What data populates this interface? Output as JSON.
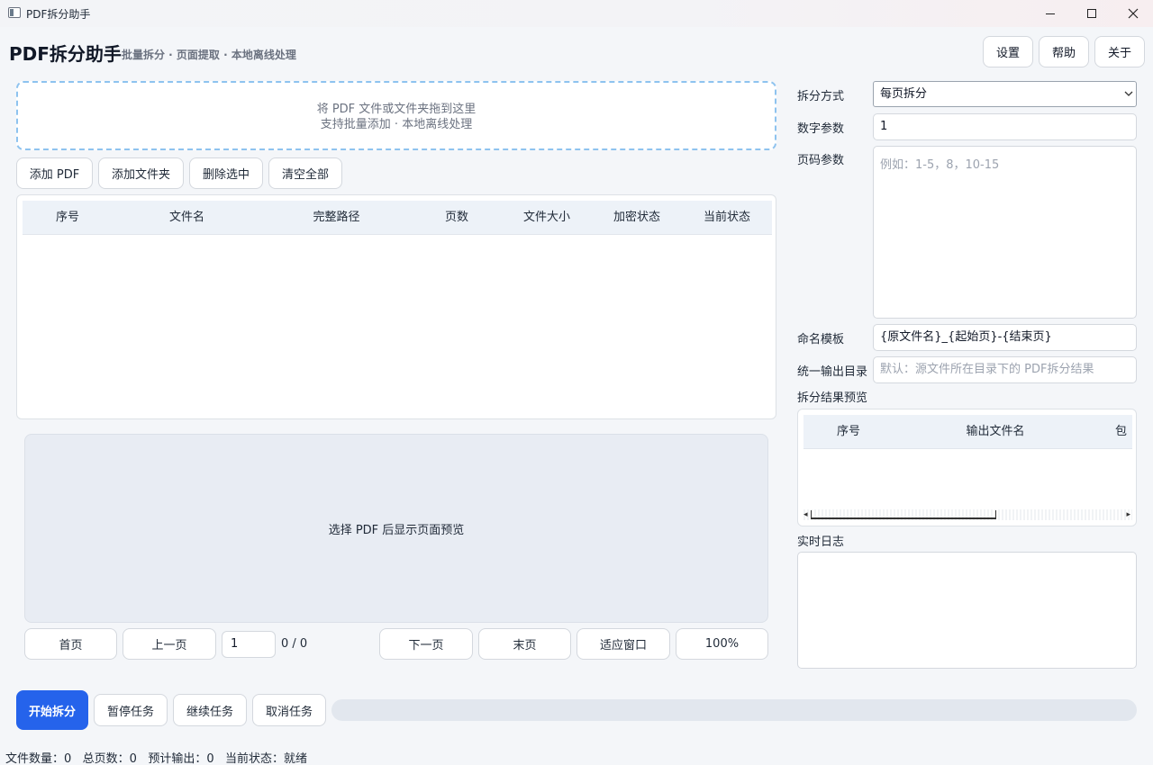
{
  "window": {
    "title": "PDF拆分助手"
  },
  "header": {
    "title": "PDF拆分助手",
    "subtitle": "批量拆分 · 页面提取 · 本地离线处理",
    "settings_label": "设置",
    "help_label": "帮助",
    "about_label": "关于"
  },
  "dropzone": {
    "line1": "将 PDF 文件或文件夹拖到这里",
    "line2": "支持批量添加 · 本地离线处理"
  },
  "file_actions": {
    "add_pdf": "添加 PDF",
    "add_folder": "添加文件夹",
    "delete_selected": "删除选中",
    "clear_all": "清空全部"
  },
  "file_table": {
    "columns": [
      "序号",
      "文件名",
      "完整路径",
      "页数",
      "文件大小",
      "加密状态",
      "当前状态"
    ],
    "rows": []
  },
  "preview": {
    "placeholder": "选择 PDF 后显示页面预览"
  },
  "pager": {
    "first": "首页",
    "prev": "上一页",
    "page_value": "1",
    "page_count": "0 / 0",
    "next": "下一页",
    "last": "末页",
    "fit": "适应窗口",
    "zoom": "100%"
  },
  "options": {
    "split_mode_label": "拆分方式",
    "split_mode_value": "每页拆分",
    "number_param_label": "数字参数",
    "number_param_value": "1",
    "page_param_label": "页码参数",
    "page_param_placeholder": "例如：1-5，8，10-15",
    "naming_label": "命名模板",
    "naming_value": "{原文件名}_{起始页}-{结束页}",
    "output_dir_label": "统一输出目录",
    "output_dir_placeholder": "默认：源文件所在目录下的 PDF拆分结果"
  },
  "result_preview": {
    "label": "拆分结果预览",
    "columns": [
      "序号",
      "输出文件名",
      "包"
    ]
  },
  "log": {
    "label": "实时日志"
  },
  "tasks": {
    "start": "开始拆分",
    "pause": "暂停任务",
    "resume": "继续任务",
    "cancel": "取消任务",
    "progress": 0
  },
  "status": {
    "text": "文件数量：0   总页数：0   预计输出：0   当前状态：就绪"
  },
  "colors": {
    "accent": "#2563eb",
    "dropzone_border": "#8ec3ef"
  }
}
